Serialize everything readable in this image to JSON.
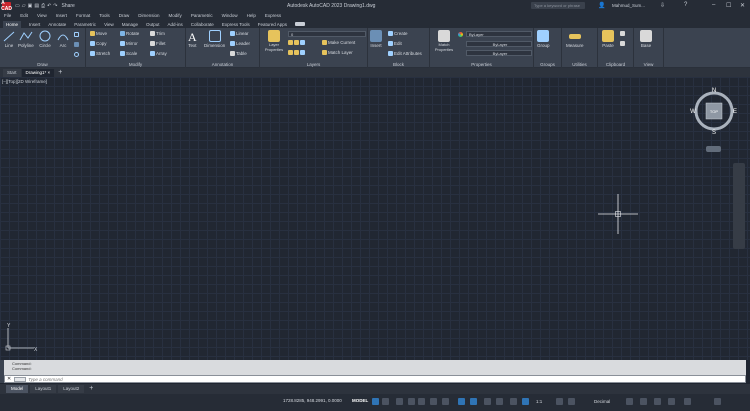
{
  "titlebar": {
    "logo": "A CAD",
    "share": "Share",
    "title": "Autodesk AutoCAD 2023  Drawing1.dwg",
    "search_placeholder": "Type a keyword or phrase",
    "user": "Mahmud_Sum...",
    "minimize": "–",
    "maximize": "☐",
    "close": "✕"
  },
  "menubar": [
    "File",
    "Edit",
    "View",
    "Insert",
    "Format",
    "Tools",
    "Draw",
    "Dimension",
    "Modify",
    "Parametric",
    "Window",
    "Help",
    "Express"
  ],
  "ribbon_tabs": [
    "Home",
    "Insert",
    "Annotate",
    "Parametric",
    "View",
    "Manage",
    "Output",
    "Add-ins",
    "Collaborate",
    "Express Tools",
    "Featured Apps"
  ],
  "ribbon": {
    "draw": {
      "label": "Draw",
      "line": "Line",
      "polyline": "Polyline",
      "circle": "Circle",
      "arc": "Arc"
    },
    "modify": {
      "label": "Modify",
      "move": "Move",
      "rotate": "Rotate",
      "trim": "Trim",
      "copy": "Copy",
      "mirror": "Mirror",
      "fillet": "Fillet",
      "stretch": "Stretch",
      "scale": "Scale",
      "array": "Array"
    },
    "annotation": {
      "label": "Annotation",
      "text": "Text",
      "dimension": "Dimension",
      "linear": "Linear",
      "leader": "Leader",
      "table": "Table"
    },
    "layers": {
      "label": "Layers",
      "layer_properties": "Layer Properties",
      "layer_value": "0",
      "make_current": "Make Current",
      "match_layer": "Match Layer"
    },
    "block": {
      "label": "Block",
      "insert": "Insert",
      "create": "Create",
      "edit": "Edit",
      "edit_attributes": "Edit Attributes"
    },
    "properties": {
      "label": "Properties",
      "match_properties": "Match Properties",
      "color": "ByLayer",
      "linetype": "ByLayer",
      "lineweight": "ByLayer"
    },
    "groups": {
      "label": "Groups",
      "group": "Group"
    },
    "utilities": {
      "label": "Utilities",
      "measure": "Measure"
    },
    "clipboard": {
      "label": "Clipboard",
      "paste": "Paste"
    },
    "view": {
      "label": "View",
      "base": "Base"
    }
  },
  "file_tabs": {
    "start": "Start",
    "drawing": "Drawing1*",
    "new": "+"
  },
  "viewport": {
    "label": "[–][Top][2D Wireframe]"
  },
  "viewcube": {
    "north": "N",
    "south": "S",
    "east": "E",
    "west": "W",
    "top": "TOP"
  },
  "command": {
    "history": [
      "Command:",
      "Command:"
    ],
    "placeholder": "Type a command"
  },
  "layout_tabs": [
    "Model",
    "Layout1",
    "Layout2",
    "+"
  ],
  "status": {
    "coords": "1728.8285, 948.2991, 0.0000",
    "model": "MODEL",
    "scale": "1:1",
    "units": "Decimal"
  },
  "colors": {
    "accent": "#2f74b5",
    "ribbon_bg": "#3b4350",
    "canvas_bg": "#212732"
  }
}
